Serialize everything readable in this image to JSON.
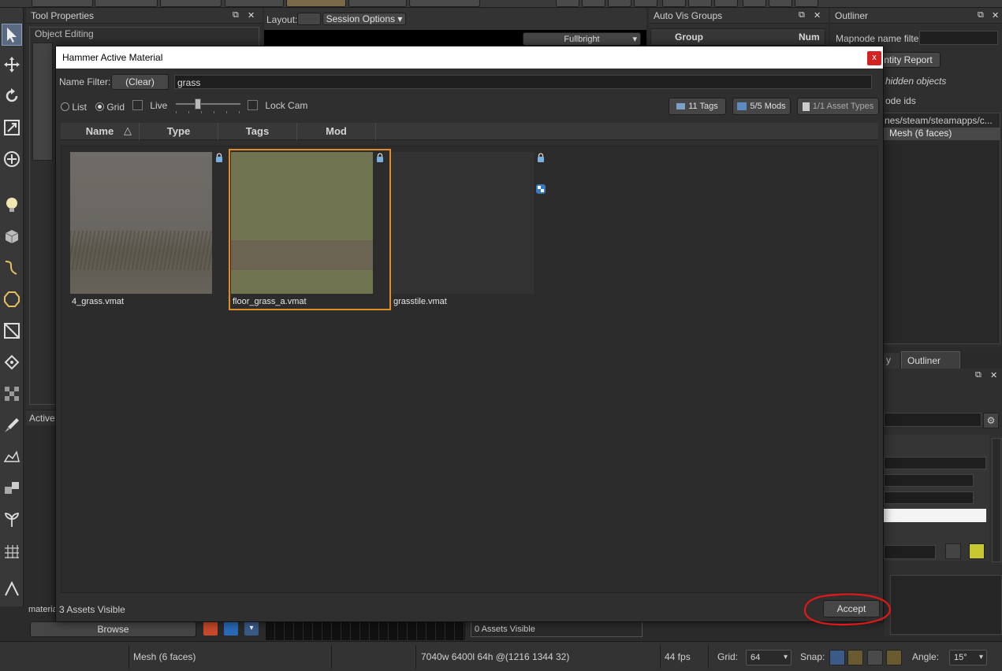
{
  "panels": {
    "tool_properties": {
      "title": "Tool Properties",
      "section": "Object Editing"
    },
    "viewport": {
      "layout_label": "Layout:",
      "session_options": "Session Options",
      "render_mode": "Fullbright"
    },
    "auto_vis_groups": {
      "title": "Auto Vis Groups",
      "col_group": "Group",
      "col_num": "Num"
    },
    "outliner": {
      "title": "Outliner",
      "filter_label": "Mapnode name filter",
      "entity_report": "n Entity Report",
      "hidden_objects": "hidden objects",
      "node_ids": "ode ids",
      "path": "nes/steam/steamapps/c...",
      "mesh_item": "Mesh (6 faces)",
      "tab_left": "y",
      "tab_outliner": "Outliner"
    },
    "active_material": {
      "title": "Active",
      "material_label": "materia",
      "browse": "Browse",
      "assets_visible": "0 Assets Visible"
    }
  },
  "dialog": {
    "title": "Hammer Active Material",
    "close": "x",
    "name_filter_label": "Name Filter:",
    "clear_button": "(Clear)",
    "filter_value": "grass",
    "view_list": "List",
    "view_grid": "Grid",
    "live_label": "Live",
    "lock_cam_label": "Lock Cam",
    "tags_button": "11 Tags",
    "mods_button": "5/5 Mods",
    "asset_types_button": "1/1 Asset Types",
    "columns": [
      "Name",
      "Type",
      "Tags",
      "Mod"
    ],
    "assets": [
      {
        "name": "4_grass.vmat",
        "selected": false,
        "color": "#6e6a64"
      },
      {
        "name": "floor_grass_a.vmat",
        "selected": true,
        "color": "#6f7550"
      },
      {
        "name": "grasstile.vmat",
        "selected": false,
        "color": "#333333"
      }
    ],
    "status": "3 Assets Visible",
    "accept_button": "Accept",
    "selection_color": "#e08a2a"
  },
  "statusbar": {
    "selection": "Mesh (6 faces)",
    "dimensions": "7040w 6400l 64h @(1216 1344 32)",
    "fps": "44 fps",
    "grid_label": "Grid:",
    "grid_value": "64",
    "snap_label": "Snap:",
    "angle_label": "Angle:",
    "angle_value": "15°"
  }
}
